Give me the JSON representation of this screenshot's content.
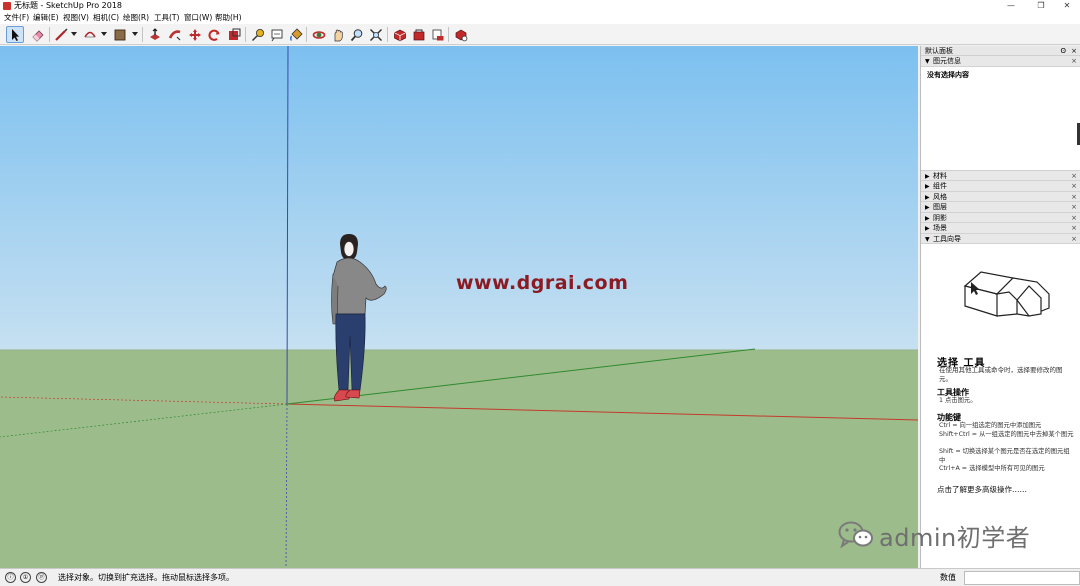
{
  "window": {
    "title": "无标题 - SketchUp Pro 2018",
    "controls": [
      "—",
      "❐",
      "✕"
    ]
  },
  "menu": [
    {
      "label": "文件(F)"
    },
    {
      "label": "编辑(E)"
    },
    {
      "label": "视图(V)"
    },
    {
      "label": "相机(C)"
    },
    {
      "label": "绘图(R)"
    },
    {
      "label": "工具(T)"
    },
    {
      "label": "窗口(W)"
    },
    {
      "label": "帮助(H)"
    }
  ],
  "toolbar": {
    "tools": [
      "select-tool",
      "eraser-tool",
      "line-tool",
      "arc-tool",
      "shape-tool",
      "push-pull-tool",
      "follow-me-tool",
      "move-tool",
      "rotate-tool",
      "scale-tool",
      "tape-measure-tool",
      "text-tool",
      "paint-bucket-tool",
      "orbit-tool",
      "pan-tool",
      "zoom-tool",
      "zoom-extents-tool",
      "3d-warehouse",
      "extension-warehouse",
      "layout-send",
      "extension-manager"
    ],
    "active_tool": "select-tool"
  },
  "viewport": {
    "watermark": "www.dgrai.com",
    "sky_color": "#9fcaea",
    "ground_color": "#9dbc8c"
  },
  "tray": {
    "title": "默认面板",
    "pin": "ʘ",
    "close": "×",
    "entity_info": {
      "header": "图元信息",
      "empty_text": "没有选择内容"
    },
    "collapsed_panels": [
      {
        "label": "材料"
      },
      {
        "label": "组件"
      },
      {
        "label": "风格"
      },
      {
        "label": "图层"
      },
      {
        "label": "阴影"
      },
      {
        "label": "场景"
      }
    ],
    "instructor": {
      "header": "工具向导",
      "tool_title": "选择 工具",
      "tool_desc": "在使用其他工具或命令时，选择要修改的图元。",
      "operations_title": "工具操作",
      "operations_text": "1  点击图元。",
      "modifiers_title": "功能键",
      "modifiers": [
        "Ctrl = 向一组选定的图元中添加图元",
        "Shift+Ctrl = 从一组选定的图元中去掉某个图元",
        "Shift = 切换选择某个图元是否在选定的图元组中",
        "Ctrl+A = 选择模型中所有可见的图元"
      ],
      "more_link": "点击了解更多高级操作……"
    }
  },
  "overlay": {
    "wechat_label": "admin初学者"
  },
  "statusbar": {
    "icons": [
      "ⓘ",
      "①",
      "ⓟ"
    ],
    "hint": "选择对象。切换到扩充选择。拖动鼠标选择多项。",
    "vcb_label": "数值",
    "vcb_value": ""
  }
}
